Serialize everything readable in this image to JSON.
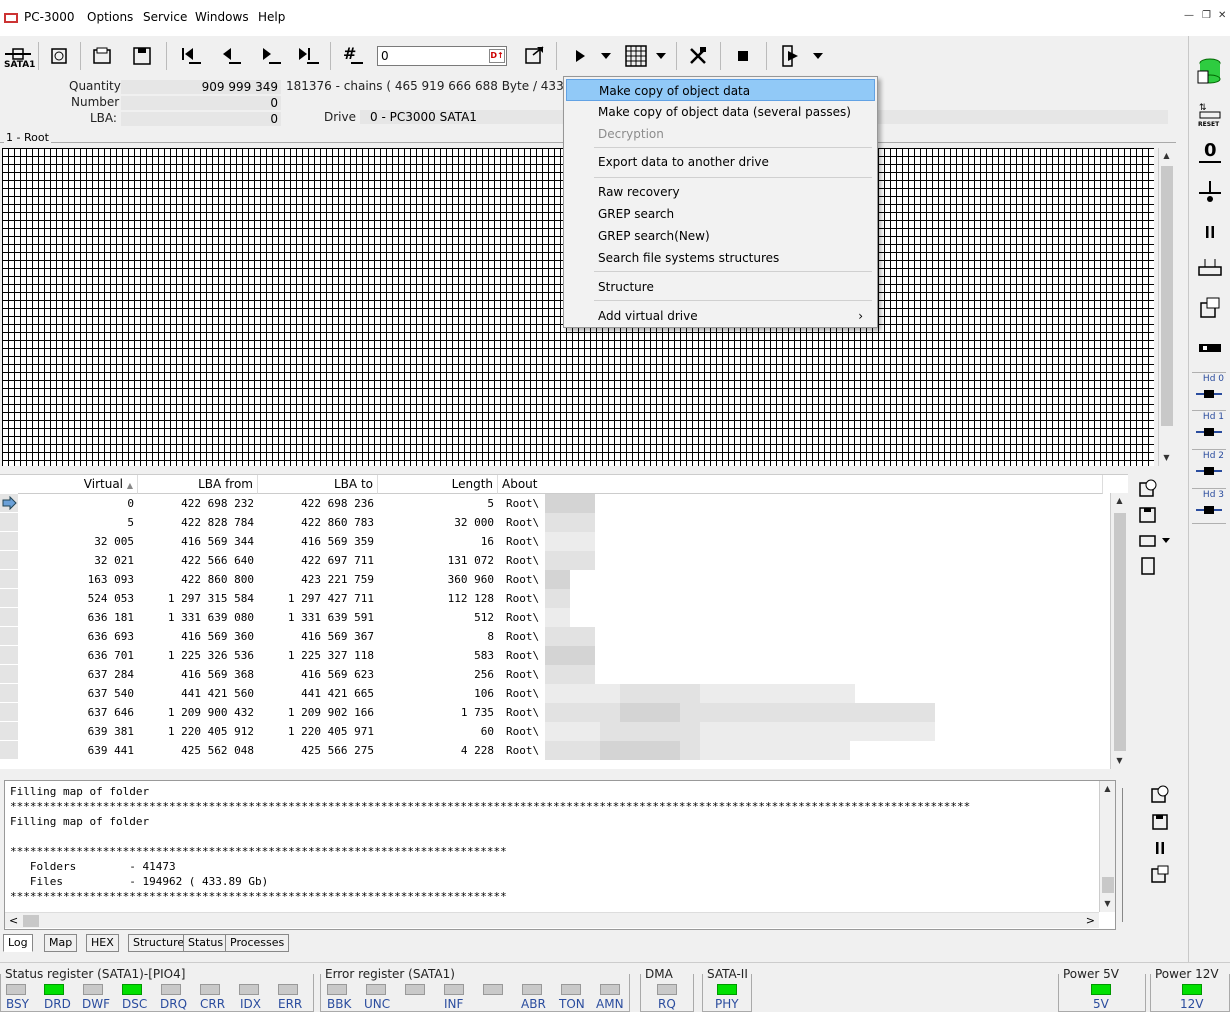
{
  "app": {
    "title": "PC-3000"
  },
  "menu": [
    "Options",
    "Service",
    "Windows",
    "Help"
  ],
  "toolbar": {
    "sata_label": "SATA1",
    "lba_input": "0"
  },
  "info": {
    "quantity_label": "Quantity",
    "quantity_value": "909 999 349",
    "chains_text": "181376 - chains  ( 465 919 666 688 Byte /  433.9",
    "number_label": "Number",
    "number_value": "0",
    "lba_label": "LBA:",
    "lba_value": "0",
    "drive_label": "Drive",
    "drive_value": "0 - PC3000 SATA1"
  },
  "map": {
    "label": "1 - Root"
  },
  "table": {
    "headers": [
      "Virtual",
      "LBA from",
      "LBA to",
      "Length",
      "About"
    ],
    "rows": [
      [
        "0",
        "422 698 232",
        "422 698 236",
        "5",
        "Root\\"
      ],
      [
        "5",
        "422 828 784",
        "422 860 783",
        "32 000",
        "Root\\"
      ],
      [
        "32 005",
        "416 569 344",
        "416 569 359",
        "16",
        "Root\\"
      ],
      [
        "32 021",
        "422 566 640",
        "422 697 711",
        "131 072",
        "Root\\"
      ],
      [
        "163 093",
        "422 860 800",
        "423 221 759",
        "360 960",
        "Root\\"
      ],
      [
        "524 053",
        "1 297 315 584",
        "1 297 427 711",
        "112 128",
        "Root\\"
      ],
      [
        "636 181",
        "1 331 639 080",
        "1 331 639 591",
        "512",
        "Root\\"
      ],
      [
        "636 693",
        "416 569 360",
        "416 569 367",
        "8",
        "Root\\"
      ],
      [
        "636 701",
        "1 225 326 536",
        "1 225 327 118",
        "583",
        "Root\\"
      ],
      [
        "637 284",
        "416 569 368",
        "416 569 623",
        "256",
        "Root\\"
      ],
      [
        "637 540",
        "441 421 560",
        "441 421 665",
        "106",
        "Root\\"
      ],
      [
        "637 646",
        "1 209 900 432",
        "1 209 902 166",
        "1 735",
        "Root\\"
      ],
      [
        "639 381",
        "1 220 405 912",
        "1 220 405 971",
        "60",
        "Root\\"
      ],
      [
        "639 441",
        "425 562 048",
        "425 566 275",
        "4 228",
        "Root\\"
      ]
    ]
  },
  "log": {
    "lines": [
      "Filling map of folder",
      "*************************************************************************************************************************************************",
      "Filling map of folder",
      "",
      "***************************************************************************",
      "   Folders        - 41473",
      "   Files          - 194962 ( 433.89 Gb)",
      "***************************************************************************"
    ]
  },
  "tabs": [
    "Log",
    "Map",
    "HEX",
    "Structure",
    "Status",
    "Processes"
  ],
  "context_menu": {
    "items": [
      {
        "label": "Make copy of object data",
        "state": "highlighted"
      },
      {
        "label": "Make copy of object data (several passes)",
        "state": "normal"
      },
      {
        "label": "Decryption",
        "state": "disabled"
      },
      {
        "label": "Export data to another drive",
        "state": "normal"
      },
      {
        "label": "Raw recovery",
        "state": "normal"
      },
      {
        "label": "GREP search",
        "state": "normal"
      },
      {
        "label": "GREP search(New)",
        "state": "normal"
      },
      {
        "label": "Search file systems structures",
        "state": "normal"
      },
      {
        "label": "Structure",
        "state": "normal"
      },
      {
        "label": "Add virtual drive",
        "state": "normal",
        "submenu": true
      }
    ]
  },
  "status": {
    "status_register": {
      "label": "Status register (SATA1)-[PIO4]",
      "leds": [
        {
          "name": "BSY",
          "on": false
        },
        {
          "name": "DRD",
          "on": true
        },
        {
          "name": "DWF",
          "on": false
        },
        {
          "name": "DSC",
          "on": true
        },
        {
          "name": "DRQ",
          "on": false
        },
        {
          "name": "CRR",
          "on": false
        },
        {
          "name": "IDX",
          "on": false
        },
        {
          "name": "ERR",
          "on": false
        }
      ]
    },
    "error_register": {
      "label": "Error register (SATA1)",
      "leds": [
        {
          "name": "BBK",
          "on": false
        },
        {
          "name": "UNC",
          "on": false
        },
        {
          "name": "",
          "on": false
        },
        {
          "name": "INF",
          "on": false
        },
        {
          "name": "",
          "on": false
        },
        {
          "name": "ABR",
          "on": false
        },
        {
          "name": "TON",
          "on": false
        },
        {
          "name": "AMN",
          "on": false
        }
      ]
    },
    "dma": {
      "label": "DMA",
      "leds": [
        {
          "name": "RQ",
          "on": false
        }
      ]
    },
    "sata2": {
      "label": "SATA-II",
      "leds": [
        {
          "name": "PHY",
          "on": true
        }
      ]
    },
    "power5": {
      "label": "Power 5V",
      "leds": [
        {
          "name": "5V",
          "on": true
        }
      ]
    },
    "power12": {
      "label": "Power 12V",
      "leds": [
        {
          "name": "12V",
          "on": true
        }
      ]
    }
  },
  "right_panel": {
    "reset_label": "RESET",
    "hd_labels": [
      "Hd 0",
      "Hd 1",
      "Hd 2",
      "Hd 3"
    ]
  },
  "colors": {
    "led_on": "#00e000",
    "menu_highlight": "#91c9f7",
    "label_blue": "#2a4c9e"
  }
}
